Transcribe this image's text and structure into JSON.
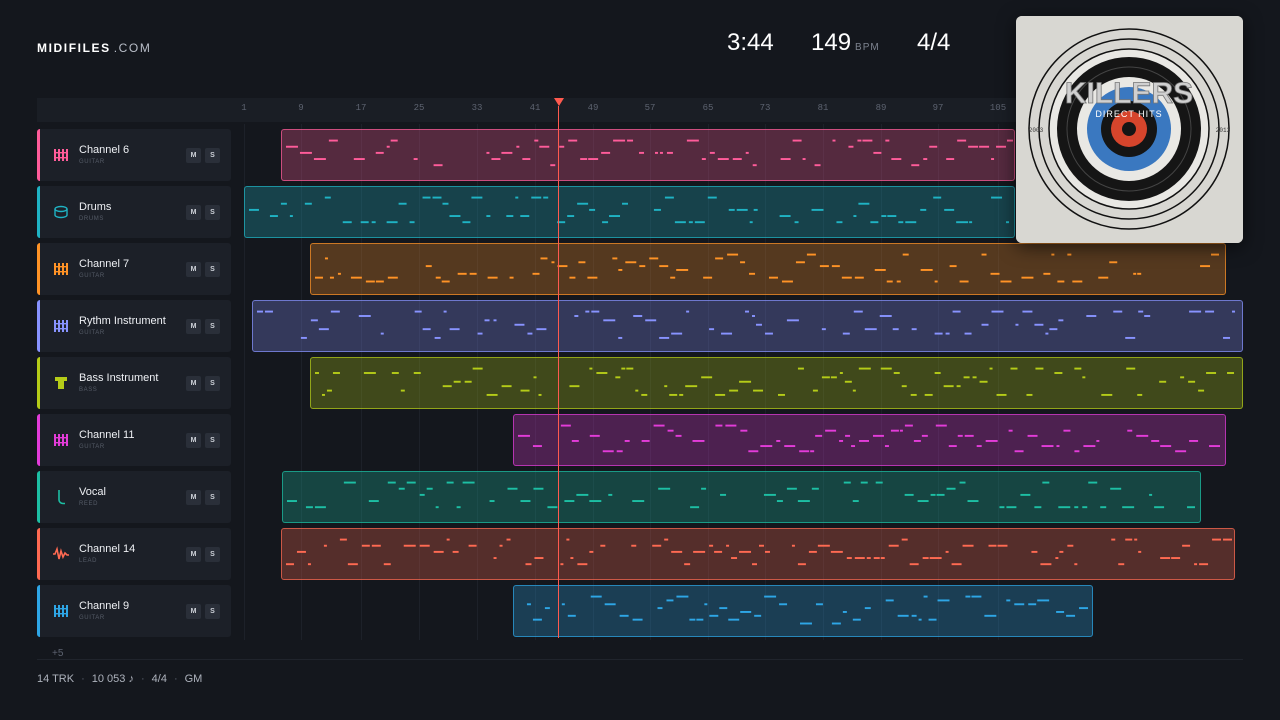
{
  "logo": {
    "brand": "MIDIFILES",
    "tld": ".COM"
  },
  "stats": {
    "time": "3:44",
    "bpm": "149",
    "bpm_unit": "BPM",
    "time_signature": "4/4"
  },
  "ruler": {
    "ticks": [
      "1",
      "9",
      "17",
      "25",
      "33",
      "41",
      "49",
      "57",
      "65",
      "73",
      "81",
      "89",
      "97",
      "105"
    ]
  },
  "tracks": [
    {
      "name": "Channel 6",
      "sub": "GUITAR",
      "icon": "guitar-icon",
      "color": "#ff5c9a",
      "mute": "M",
      "solo": "S"
    },
    {
      "name": "Drums",
      "sub": "DRUMS",
      "icon": "drum-icon",
      "color": "#1fb3c4",
      "mute": "M",
      "solo": "S"
    },
    {
      "name": "Channel 7",
      "sub": "GUITAR",
      "icon": "guitar-icon",
      "color": "#ff9326",
      "mute": "M",
      "solo": "S"
    },
    {
      "name": "Rythm Instrument",
      "sub": "GUITAR",
      "icon": "guitar-icon",
      "color": "#8893ff",
      "mute": "M",
      "solo": "S"
    },
    {
      "name": "Bass Instrument",
      "sub": "BASS",
      "icon": "bass-icon",
      "color": "#b5cc18",
      "mute": "M",
      "solo": "S"
    },
    {
      "name": "Channel 11",
      "sub": "GUITAR",
      "icon": "guitar-icon",
      "color": "#e33cd9",
      "mute": "M",
      "solo": "S"
    },
    {
      "name": "Vocal",
      "sub": "REED",
      "icon": "reed-icon",
      "color": "#1dbfa4",
      "mute": "M",
      "solo": "S"
    },
    {
      "name": "Channel 14",
      "sub": "LEAD",
      "icon": "lead-icon",
      "color": "#ff6a52",
      "mute": "M",
      "solo": "S"
    },
    {
      "name": "Channel 9",
      "sub": "GUITAR",
      "icon": "guitar-icon",
      "color": "#2ea6e6",
      "mute": "M",
      "solo": "S"
    }
  ],
  "more_tracks": "+5",
  "footer": {
    "tracks": "14 TRK",
    "notes": "10 053 ♪",
    "signature": "4/4",
    "standard": "GM"
  },
  "album": {
    "band": "KILLERS",
    "title": "DIRECT HITS",
    "year_left": "2003",
    "year_right": "2013"
  }
}
